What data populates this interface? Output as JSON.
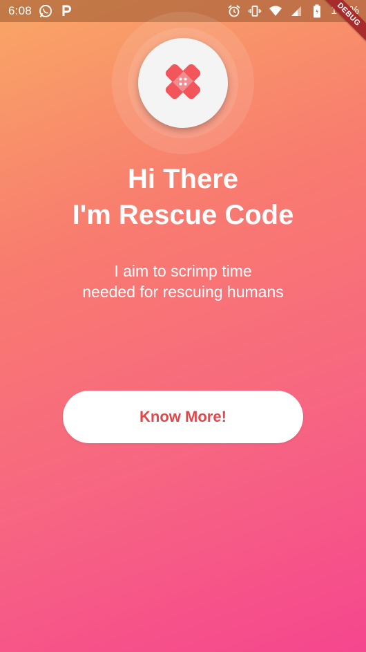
{
  "status_bar": {
    "time": "6:08",
    "battery": "100%",
    "left_icons": [
      "whatsapp-icon",
      "p-notification-icon"
    ],
    "right_icons": [
      "alarm-icon",
      "vibrate-icon",
      "wifi-icon",
      "signal-icon",
      "battery-icon"
    ]
  },
  "debug_banner": "DEBUG",
  "logo": {
    "icon": "bandage-icon",
    "color": "#f2555a"
  },
  "headline": {
    "line1": "Hi There",
    "line2": "I'm Rescue Code"
  },
  "subtitle": {
    "line1": "I aim to scrimp time",
    "line2": "needed for rescuing humans"
  },
  "cta": {
    "label": "Know More!",
    "color": "#e2474a"
  },
  "colors": {
    "gradient_start": "#f9a765",
    "gradient_end": "#f5468e"
  }
}
